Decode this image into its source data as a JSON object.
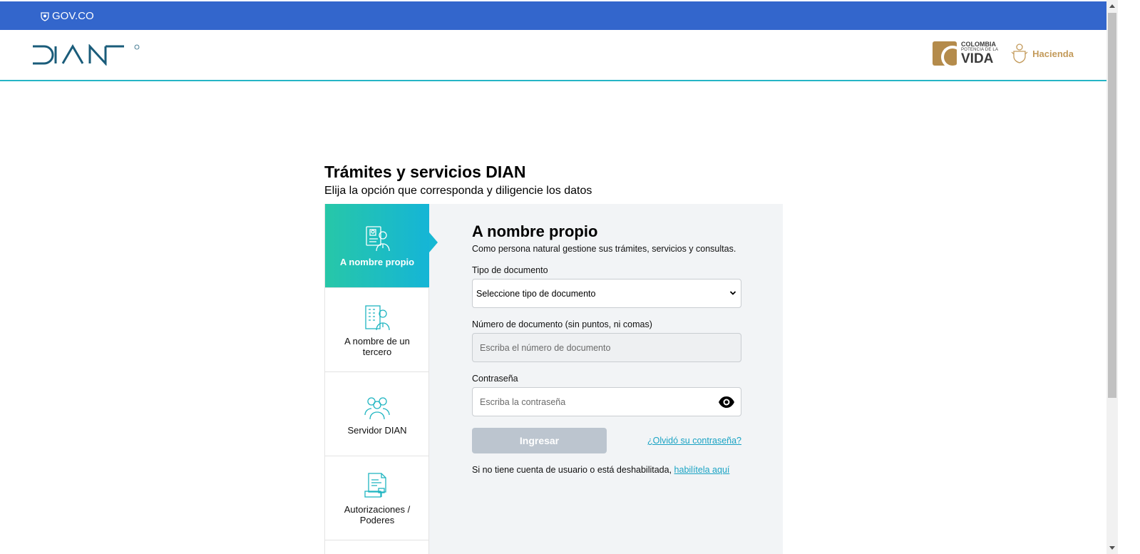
{
  "gov_bar": {
    "label": "GOV.CO"
  },
  "header": {
    "logo_text": "DIAN",
    "colombia": {
      "line1": "COLOMBIA",
      "line2": "POTENCIA DE LA",
      "line3": "VIDA"
    },
    "hacienda": "Hacienda"
  },
  "page": {
    "title": "Trámites y servicios DIAN",
    "subtitle": "Elija la opción que corresponda y diligencie los datos"
  },
  "tabs": [
    {
      "label": "A nombre propio",
      "icon": "person-id-card-icon",
      "active": true
    },
    {
      "label": "A nombre de un tercero",
      "icon": "building-person-icon",
      "active": false
    },
    {
      "label": "Servidor DIAN",
      "icon": "group-people-icon",
      "active": false
    },
    {
      "label": "Autorizaciones / Poderes",
      "icon": "document-stamp-icon",
      "active": false
    }
  ],
  "form": {
    "heading": "A nombre propio",
    "description": "Como persona natural gestione sus trámites, servicios y consultas.",
    "doc_type": {
      "label": "Tipo de documento",
      "value": "Seleccione tipo de documento"
    },
    "doc_number": {
      "label": "Número de documento (sin puntos, ni comas)",
      "placeholder": "Escriba el número de documento"
    },
    "password": {
      "label": "Contraseña",
      "placeholder": "Escriba la contraseña"
    },
    "submit": "Ingresar",
    "forgot": "¿Olvidó su contraseña?",
    "signup_text": "Si no tiene cuenta de usuario o está deshabilitada,",
    "signup_link": "habilítela aquí"
  },
  "colors": {
    "gov_blue": "#3366cc",
    "accent_teal": "#26b5c6",
    "link": "#1aa3c4",
    "button_disabled": "#bcc5cf"
  }
}
